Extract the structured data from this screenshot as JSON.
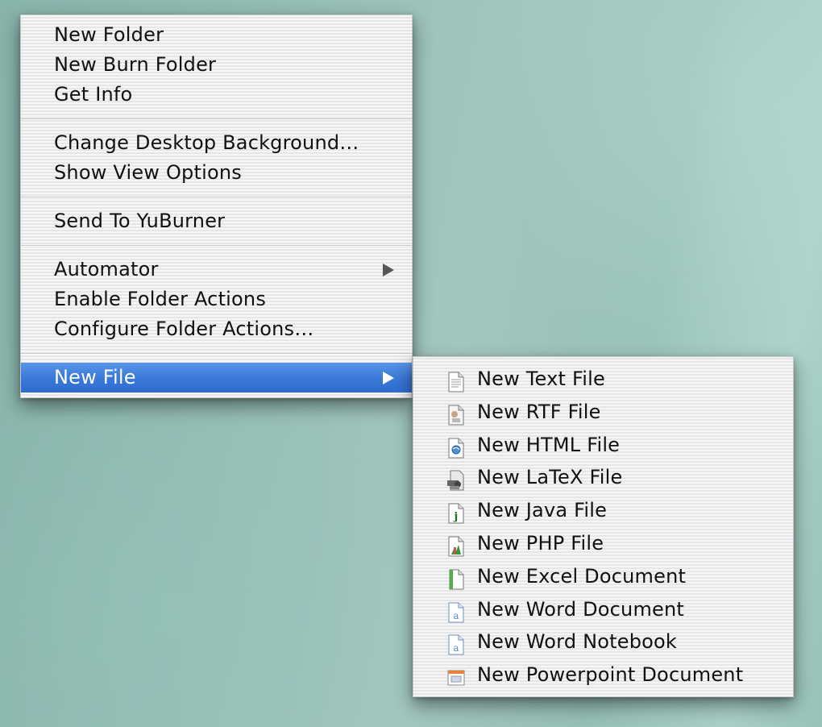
{
  "main_menu": {
    "groups": [
      {
        "items": [
          {
            "label": "New Folder"
          },
          {
            "label": "New Burn Folder"
          },
          {
            "label": "Get Info"
          }
        ]
      },
      {
        "items": [
          {
            "label": "Change Desktop Background…"
          },
          {
            "label": "Show View Options"
          }
        ]
      },
      {
        "items": [
          {
            "label": "Send To YuBurner"
          }
        ]
      },
      {
        "items": [
          {
            "label": "Automator",
            "has_submenu": true
          },
          {
            "label": "Enable Folder Actions"
          },
          {
            "label": "Configure Folder Actions…"
          }
        ]
      },
      {
        "items": [
          {
            "label": "New File",
            "has_submenu": true,
            "highlighted": true
          }
        ]
      }
    ]
  },
  "sub_menu": {
    "items": [
      {
        "label": "New Text File",
        "icon": "text-file-icon"
      },
      {
        "label": "New RTF File",
        "icon": "rtf-file-icon"
      },
      {
        "label": "New HTML File",
        "icon": "html-file-icon"
      },
      {
        "label": "New LaTeX File",
        "icon": "latex-file-icon"
      },
      {
        "label": "New Java File",
        "icon": "java-file-icon"
      },
      {
        "label": "New PHP File",
        "icon": "php-file-icon"
      },
      {
        "label": "New Excel Document",
        "icon": "excel-document-icon"
      },
      {
        "label": "New Word Document",
        "icon": "word-document-icon"
      },
      {
        "label": "New Word Notebook",
        "icon": "word-notebook-icon"
      },
      {
        "label": "New Powerpoint Document",
        "icon": "powerpoint-document-icon"
      }
    ]
  },
  "colors": {
    "highlight": "#3b7ad9",
    "menu_bg": "#ececec",
    "desktop": "#94bdb4"
  }
}
